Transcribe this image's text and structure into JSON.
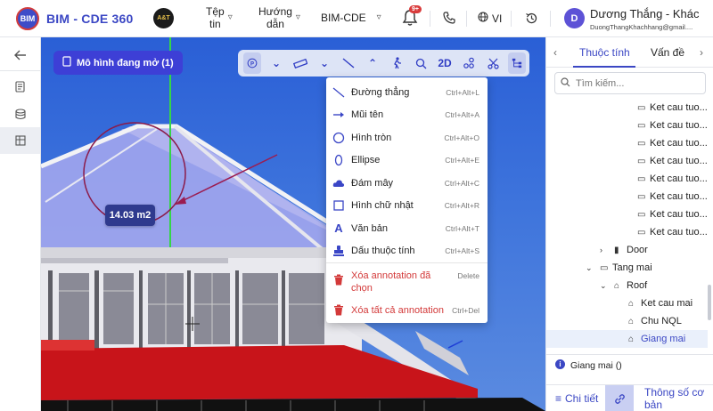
{
  "header": {
    "logo_text": "BIM",
    "app_title": "BIM - CDE 360",
    "partner_logo_text": "A&T",
    "menu": [
      {
        "label_line1": "Tệp",
        "label_line2": "tin"
      },
      {
        "label_line1": "Hướng",
        "label_line2": "dẫn"
      },
      {
        "label_line1": "BIM-CDE",
        "label_line2": ""
      }
    ],
    "notification_badge": "9+",
    "language": "VI",
    "user": {
      "initial": "D",
      "name": "Dương Thắng - Khác",
      "email": "DuongThangKhachhang@gmail...."
    }
  },
  "viewer": {
    "open_models_label": "Mô hình đang mở (1)",
    "toolbar": {
      "view_2d_label": "2D"
    },
    "measure_label": "14.03 m2"
  },
  "dropdown": {
    "items": [
      {
        "label": "Đường thẳng",
        "shortcut": "Ctrl+Alt+L",
        "icon": "line-icon"
      },
      {
        "label": "Mũi tên",
        "shortcut": "Ctrl+Alt+A",
        "icon": "arrow-icon"
      },
      {
        "label": "Hình tròn",
        "shortcut": "Ctrl+Alt+O",
        "icon": "circle-icon"
      },
      {
        "label": "Ellipse",
        "shortcut": "Ctrl+Alt+E",
        "icon": "ellipse-icon"
      },
      {
        "label": "Đám mây",
        "shortcut": "Ctrl+Alt+C",
        "icon": "cloud-icon"
      },
      {
        "label": "Hình chữ nhật",
        "shortcut": "Ctrl+Alt+R",
        "icon": "rectangle-icon"
      },
      {
        "label": "Văn bản",
        "shortcut": "Ctrl+Alt+T",
        "icon": "text-icon"
      },
      {
        "label": "Dấu thuộc tính",
        "shortcut": "Ctrl+Alt+S",
        "icon": "stamp-icon"
      }
    ],
    "danger_items": [
      {
        "label_line1": "Xóa annotation đã",
        "label_line2": "chọn",
        "shortcut": "Delete",
        "icon": "trash-icon"
      },
      {
        "label_line1": "Xóa tất cả annotation",
        "label_line2": "",
        "shortcut": "Ctrl+Del",
        "icon": "trash-icon"
      }
    ]
  },
  "right_panel": {
    "tabs": [
      "Thuộc tính",
      "Vấn đề"
    ],
    "search_placeholder": "Tìm kiếm...",
    "tree": [
      {
        "label": "Ket cau tuo...",
        "level": 4
      },
      {
        "label": "Ket cau tuo...",
        "level": 4
      },
      {
        "label": "Ket cau tuo...",
        "level": 4
      },
      {
        "label": "Ket cau tuo...",
        "level": 4
      },
      {
        "label": "Ket cau tuo...",
        "level": 4
      },
      {
        "label": "Ket cau tuo...",
        "level": 4
      },
      {
        "label": "Ket cau tuo...",
        "level": 4
      },
      {
        "label": "Ket cau tuo...",
        "level": 4
      },
      {
        "label": "Door",
        "level": 2
      },
      {
        "label": "Tang mai",
        "level": 1
      },
      {
        "label": "Roof",
        "level": 2
      },
      {
        "label": "Ket cau mai",
        "level": 3
      },
      {
        "label": "Chu NQL",
        "level": 3
      },
      {
        "label": "Giang mai",
        "level": 3
      }
    ],
    "info_text": "Giang mai ()",
    "bottom_tabs": {
      "detail": "Chi tiết",
      "params": "Thông số cơ bản"
    }
  }
}
